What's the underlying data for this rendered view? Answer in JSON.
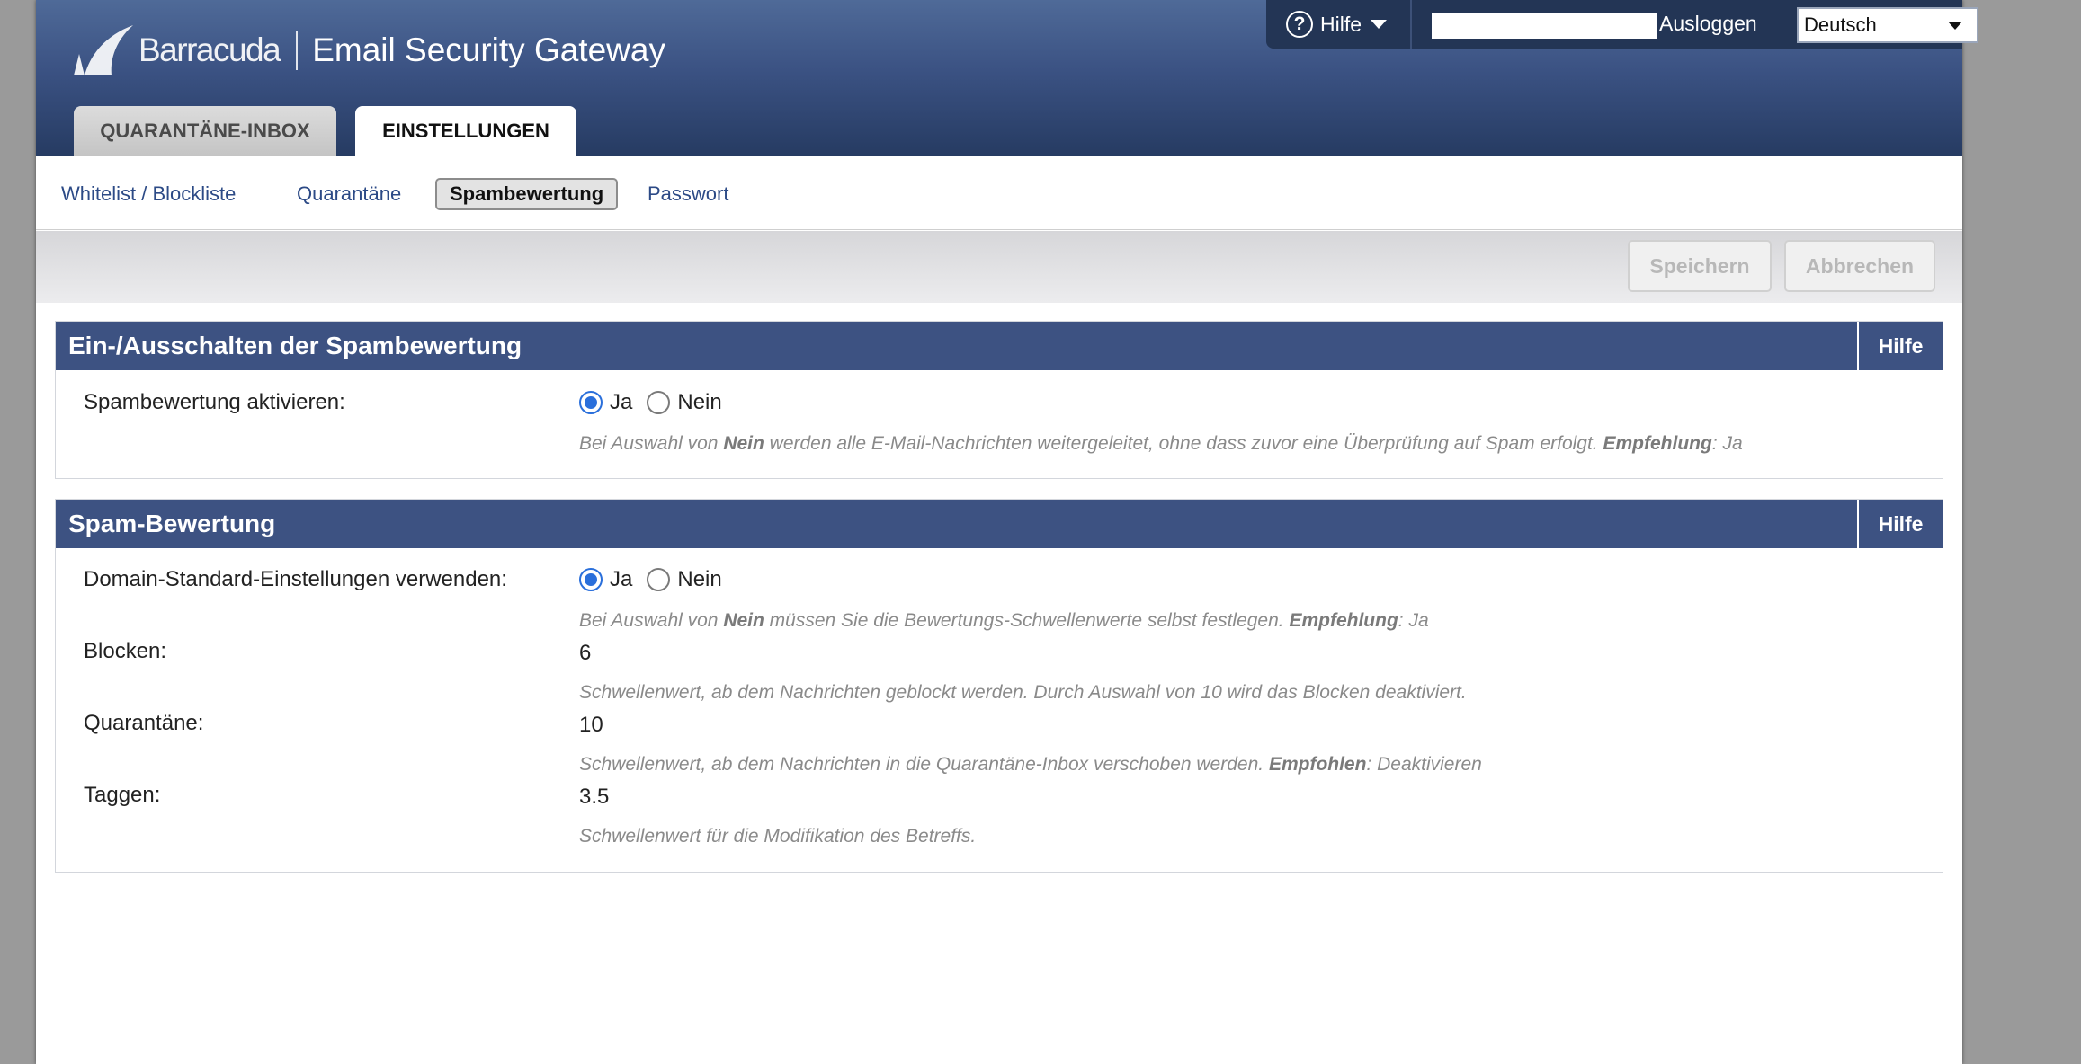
{
  "header": {
    "logo_text": "Barracuda",
    "product_name": "Email Security Gateway",
    "help_label": "Hilfe",
    "help_symbol": "?",
    "user_field_value": "",
    "logout_label": "Ausloggen",
    "language": "Deutsch"
  },
  "main_tabs": [
    {
      "label": "QUARANTÄNE-INBOX",
      "active": false
    },
    {
      "label": "EINSTELLUNGEN",
      "active": true
    }
  ],
  "sub_nav": [
    {
      "label": "Whitelist / Blockliste",
      "active": false
    },
    {
      "label": "Quarantäne",
      "active": false
    },
    {
      "label": "Spambewertung",
      "active": true
    },
    {
      "label": "Passwort",
      "active": false
    }
  ],
  "actions": {
    "save_label": "Speichern",
    "cancel_label": "Abbrechen",
    "enabled": false
  },
  "sections": [
    {
      "title": "Ein-/Ausschalten der Spambewertung",
      "help_label": "Hilfe",
      "rows": [
        {
          "label": "Spambewertung aktivieren:",
          "options": [
            "Ja",
            "Nein"
          ],
          "selected": "Ja",
          "hint_pre": "Bei Auswahl von ",
          "hint_b1": "Nein",
          "hint_mid": " werden alle E-Mail-Nachrichten weitergeleitet, ohne dass zuvor eine Überprüfung auf Spam erfolgt. ",
          "hint_b2": "Empfehlung",
          "hint_post": ": Ja"
        }
      ]
    },
    {
      "title": "Spam-Bewertung",
      "help_label": "Hilfe",
      "rows": [
        {
          "label": "Domain-Standard-Einstellungen verwenden:",
          "options": [
            "Ja",
            "Nein"
          ],
          "selected": "Ja",
          "hint_pre": "Bei Auswahl von ",
          "hint_b1": "Nein",
          "hint_mid": " müssen Sie die Bewertungs-Schwellenwerte selbst festlegen. ",
          "hint_b2": "Empfehlung",
          "hint_post": ": Ja"
        },
        {
          "label": "Blocken:",
          "value": "6",
          "hint": "Schwellenwert, ab dem Nachrichten geblockt werden. Durch Auswahl von 10 wird das Blocken deaktiviert."
        },
        {
          "label": "Quarantäne:",
          "value": "10",
          "hint_pre": "Schwellenwert, ab dem Nachrichten in die Quarantäne-Inbox verschoben werden. ",
          "hint_b": "Empfohlen",
          "hint_post": ": Deaktivieren"
        },
        {
          "label": "Taggen:",
          "value": "3.5",
          "hint": "Schwellenwert für die Modifikation des Betreffs."
        }
      ]
    }
  ],
  "colors": {
    "header_top": "#4f6a98",
    "header_bottom": "#263b62",
    "section_header": "#3d5282",
    "link": "#2c4a86",
    "radio_selected": "#2a6fdb"
  }
}
